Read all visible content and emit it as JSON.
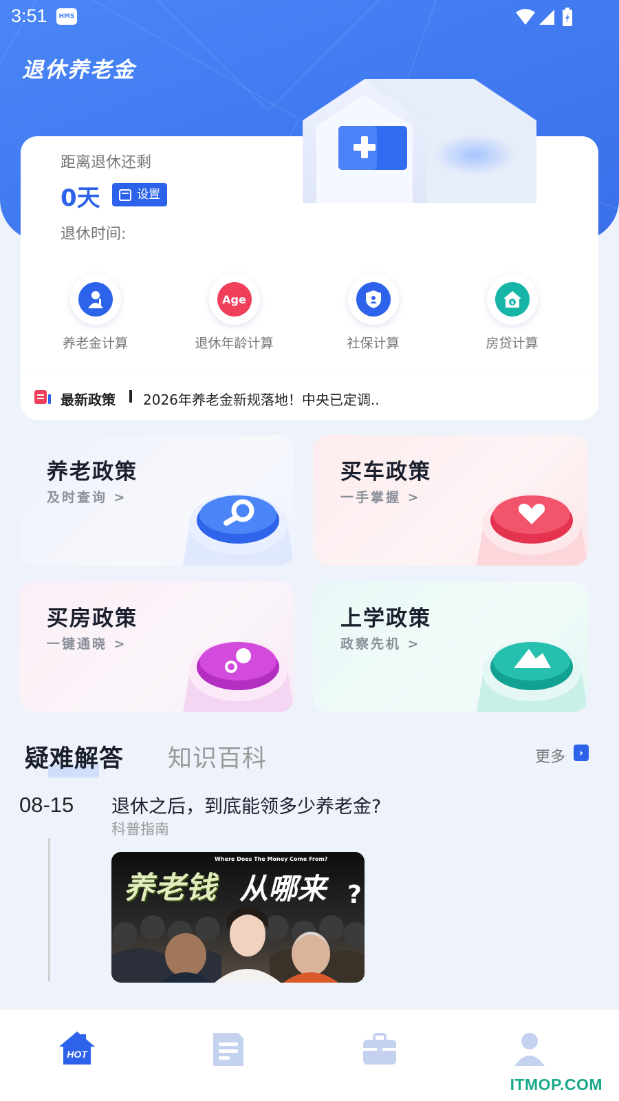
{
  "status_bar": {
    "time": "3:51",
    "hms_badge": "HMS",
    "wifi_icon": "wifi-icon",
    "signal_icon": "signal-icon",
    "battery_icon": "battery-charging-icon"
  },
  "header": {
    "app_title": "退休养老金"
  },
  "retirement_card": {
    "remaining_label": "距离退休还剩",
    "days_value": "0天",
    "set_button_label": "设置",
    "retire_time_label": "退休时间:",
    "calculators": [
      {
        "label": "养老金计算",
        "icon": "pension-person-icon",
        "color": "#2d63ea"
      },
      {
        "label": "退休年龄计算",
        "icon_text": "Age",
        "icon": "age-icon",
        "color": "#ef3f5b"
      },
      {
        "label": "社保计算",
        "icon": "shield-icon",
        "color": "#2d63ea"
      },
      {
        "label": "房贷计算",
        "icon": "house-dollar-icon",
        "color": "#17b5a8"
      }
    ],
    "news": {
      "title": "最新政策",
      "text": "2026年养老金新规落地！中央已定调.."
    }
  },
  "policies": [
    {
      "title": "养老政策",
      "subtitle": "及时查询 >",
      "icon": "magnifier-icon",
      "color": "#2d63ea"
    },
    {
      "title": "买车政策",
      "subtitle": "一手掌握 >",
      "icon": "heart-icon",
      "color": "#ef3f5b"
    },
    {
      "title": "买房政策",
      "subtitle": "一键通晓 >",
      "icon": "key-icon",
      "color": "#c13ed0"
    },
    {
      "title": "上学政策",
      "subtitle": "政察先机 >",
      "icon": "graduation-icon",
      "color": "#1fb5a3"
    }
  ],
  "tabs": {
    "active": "疑难解答",
    "inactive": "知识百科",
    "more": "更多"
  },
  "article": {
    "date": "08-15",
    "title": "退休之后，到底能领多少养老金?",
    "category": "科普指南",
    "image_subtitle_en": "Where Does The Money Come From?",
    "image_title_part1": "养老钱",
    "image_title_part2": "从哪来",
    "image_title_q": "?"
  },
  "bottom_nav": {
    "items": [
      {
        "name": "home-hot-icon",
        "label": "HOT",
        "active": true
      },
      {
        "name": "document-icon"
      },
      {
        "name": "briefcase-icon"
      },
      {
        "name": "profile-icon"
      }
    ],
    "watermark": "ITMOP.COM"
  }
}
